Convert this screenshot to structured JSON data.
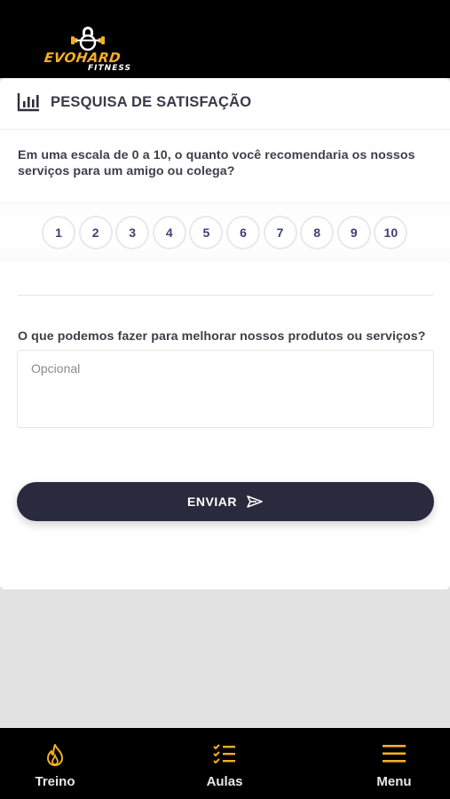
{
  "header": {
    "logo_brand": "EVOHARD",
    "logo_sub": "FITNESS",
    "brand_color": "#f4b024"
  },
  "survey": {
    "icon": "bar-chart-icon",
    "title": "PESQUISA DE SATISFAÇÃO",
    "question": "Em uma escala de 0 a 10, o quanto você recomendaria os nossos serviços para um amigo ou colega?",
    "scale": [
      "1",
      "2",
      "3",
      "4",
      "5",
      "6",
      "7",
      "8",
      "9",
      "10"
    ],
    "improve_question": "O que podemos fazer para melhorar nossos produtos ou serviços?",
    "comment_placeholder": "Opcional",
    "submit_label": "ENVIAR",
    "submit_icon": "send-icon",
    "button_color": "#292a3e"
  },
  "tabbar": {
    "accent": "#f4b024",
    "items": [
      {
        "label": "Treino",
        "icon": "flame-icon"
      },
      {
        "label": "Aulas",
        "icon": "checklist-icon"
      },
      {
        "label": "Menu",
        "icon": "hamburger-menu-icon"
      }
    ]
  }
}
